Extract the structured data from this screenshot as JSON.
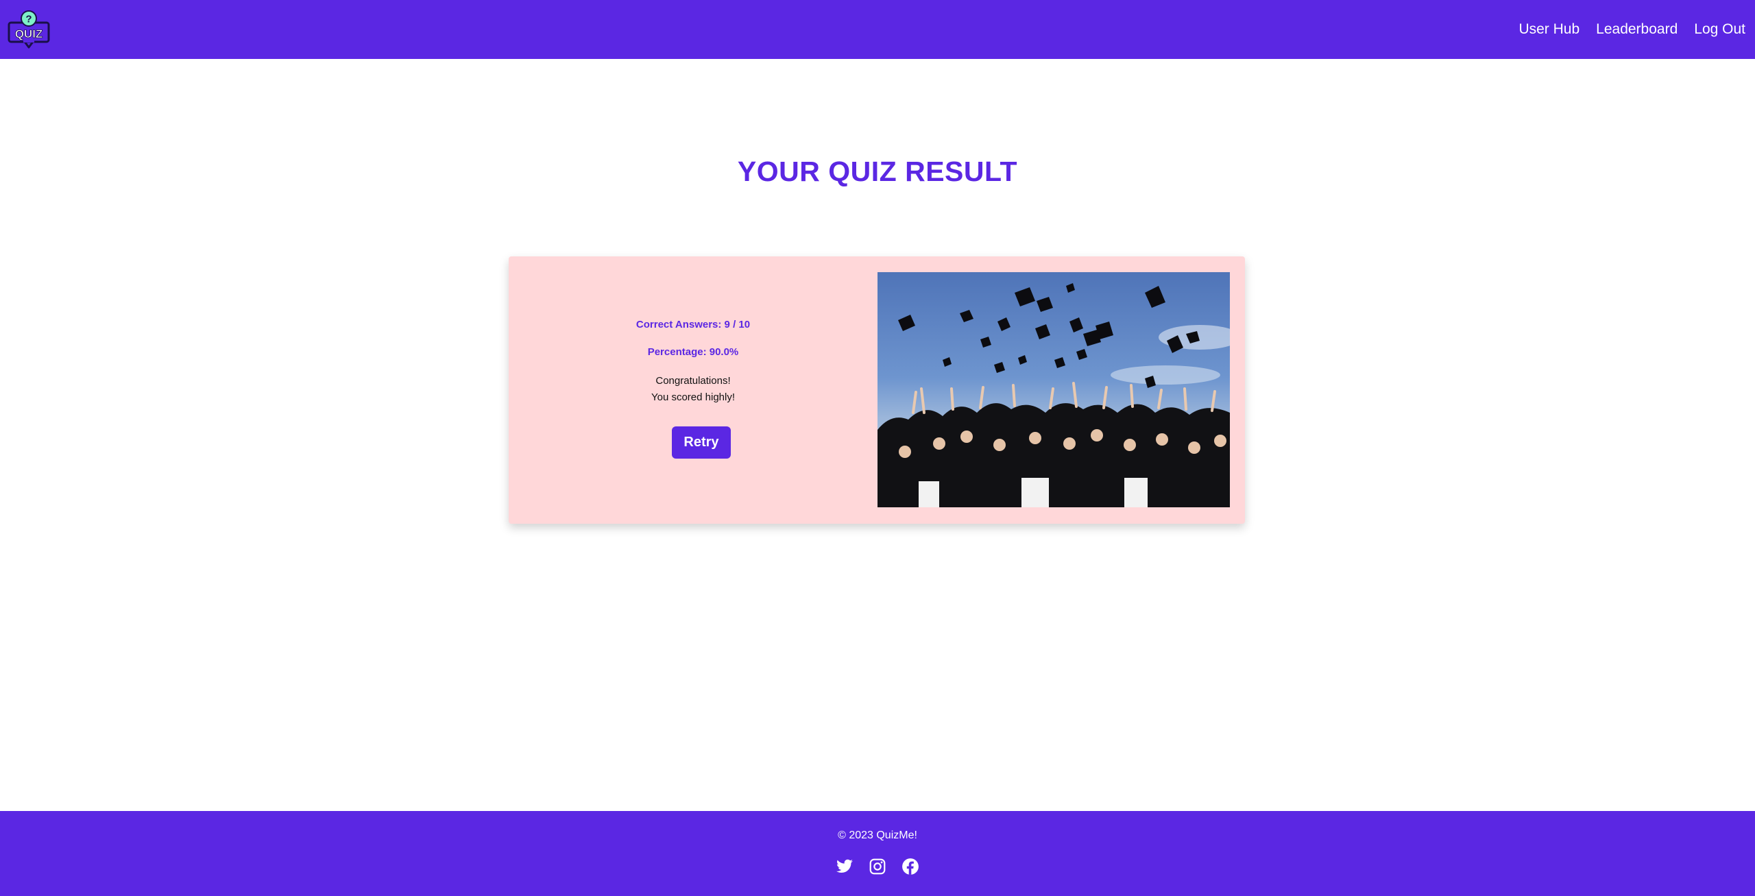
{
  "header": {
    "logo_text": "QUIZ",
    "nav": [
      {
        "label": "User Hub"
      },
      {
        "label": "Leaderboard"
      },
      {
        "label": "Log Out"
      }
    ]
  },
  "main": {
    "title": "YOUR QUIZ RESULT",
    "result": {
      "correct_answers": "Correct Answers: 9 / 10",
      "percentage": "Percentage: 90.0%",
      "message_line1": "Congratulations!",
      "message_line2": "You scored highly!",
      "retry_label": "Retry",
      "image_subject": "graduates-throwing-caps-photo"
    }
  },
  "footer": {
    "copyright": "© 2023 QuizMe!",
    "socials": [
      {
        "icon": "twitter-icon"
      },
      {
        "icon": "instagram-icon"
      },
      {
        "icon": "facebook-icon"
      }
    ]
  },
  "colors": {
    "brand": "#5b27e3",
    "card_bg": "#ffd7d9",
    "white": "#ffffff"
  }
}
